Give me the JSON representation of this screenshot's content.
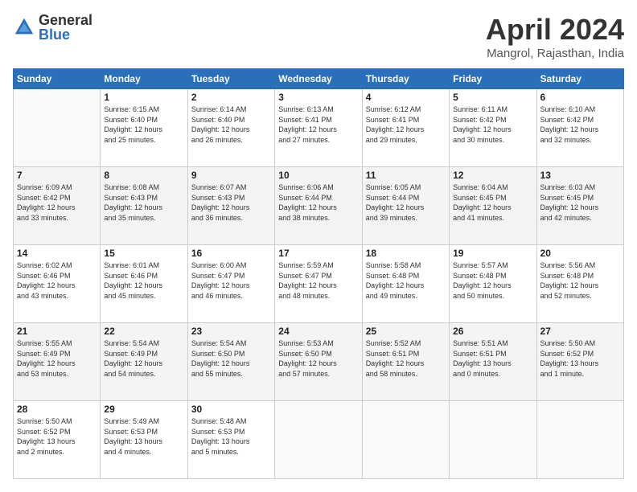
{
  "logo": {
    "general": "General",
    "blue": "Blue"
  },
  "title": {
    "month": "April 2024",
    "location": "Mangrol, Rajasthan, India"
  },
  "days_header": [
    "Sunday",
    "Monday",
    "Tuesday",
    "Wednesday",
    "Thursday",
    "Friday",
    "Saturday"
  ],
  "weeks": [
    [
      {
        "day": "",
        "info": ""
      },
      {
        "day": "1",
        "info": "Sunrise: 6:15 AM\nSunset: 6:40 PM\nDaylight: 12 hours\nand 25 minutes."
      },
      {
        "day": "2",
        "info": "Sunrise: 6:14 AM\nSunset: 6:40 PM\nDaylight: 12 hours\nand 26 minutes."
      },
      {
        "day": "3",
        "info": "Sunrise: 6:13 AM\nSunset: 6:41 PM\nDaylight: 12 hours\nand 27 minutes."
      },
      {
        "day": "4",
        "info": "Sunrise: 6:12 AM\nSunset: 6:41 PM\nDaylight: 12 hours\nand 29 minutes."
      },
      {
        "day": "5",
        "info": "Sunrise: 6:11 AM\nSunset: 6:42 PM\nDaylight: 12 hours\nand 30 minutes."
      },
      {
        "day": "6",
        "info": "Sunrise: 6:10 AM\nSunset: 6:42 PM\nDaylight: 12 hours\nand 32 minutes."
      }
    ],
    [
      {
        "day": "7",
        "info": "Sunrise: 6:09 AM\nSunset: 6:42 PM\nDaylight: 12 hours\nand 33 minutes."
      },
      {
        "day": "8",
        "info": "Sunrise: 6:08 AM\nSunset: 6:43 PM\nDaylight: 12 hours\nand 35 minutes."
      },
      {
        "day": "9",
        "info": "Sunrise: 6:07 AM\nSunset: 6:43 PM\nDaylight: 12 hours\nand 36 minutes."
      },
      {
        "day": "10",
        "info": "Sunrise: 6:06 AM\nSunset: 6:44 PM\nDaylight: 12 hours\nand 38 minutes."
      },
      {
        "day": "11",
        "info": "Sunrise: 6:05 AM\nSunset: 6:44 PM\nDaylight: 12 hours\nand 39 minutes."
      },
      {
        "day": "12",
        "info": "Sunrise: 6:04 AM\nSunset: 6:45 PM\nDaylight: 12 hours\nand 41 minutes."
      },
      {
        "day": "13",
        "info": "Sunrise: 6:03 AM\nSunset: 6:45 PM\nDaylight: 12 hours\nand 42 minutes."
      }
    ],
    [
      {
        "day": "14",
        "info": "Sunrise: 6:02 AM\nSunset: 6:46 PM\nDaylight: 12 hours\nand 43 minutes."
      },
      {
        "day": "15",
        "info": "Sunrise: 6:01 AM\nSunset: 6:46 PM\nDaylight: 12 hours\nand 45 minutes."
      },
      {
        "day": "16",
        "info": "Sunrise: 6:00 AM\nSunset: 6:47 PM\nDaylight: 12 hours\nand 46 minutes."
      },
      {
        "day": "17",
        "info": "Sunrise: 5:59 AM\nSunset: 6:47 PM\nDaylight: 12 hours\nand 48 minutes."
      },
      {
        "day": "18",
        "info": "Sunrise: 5:58 AM\nSunset: 6:48 PM\nDaylight: 12 hours\nand 49 minutes."
      },
      {
        "day": "19",
        "info": "Sunrise: 5:57 AM\nSunset: 6:48 PM\nDaylight: 12 hours\nand 50 minutes."
      },
      {
        "day": "20",
        "info": "Sunrise: 5:56 AM\nSunset: 6:48 PM\nDaylight: 12 hours\nand 52 minutes."
      }
    ],
    [
      {
        "day": "21",
        "info": "Sunrise: 5:55 AM\nSunset: 6:49 PM\nDaylight: 12 hours\nand 53 minutes."
      },
      {
        "day": "22",
        "info": "Sunrise: 5:54 AM\nSunset: 6:49 PM\nDaylight: 12 hours\nand 54 minutes."
      },
      {
        "day": "23",
        "info": "Sunrise: 5:54 AM\nSunset: 6:50 PM\nDaylight: 12 hours\nand 55 minutes."
      },
      {
        "day": "24",
        "info": "Sunrise: 5:53 AM\nSunset: 6:50 PM\nDaylight: 12 hours\nand 57 minutes."
      },
      {
        "day": "25",
        "info": "Sunrise: 5:52 AM\nSunset: 6:51 PM\nDaylight: 12 hours\nand 58 minutes."
      },
      {
        "day": "26",
        "info": "Sunrise: 5:51 AM\nSunset: 6:51 PM\nDaylight: 13 hours\nand 0 minutes."
      },
      {
        "day": "27",
        "info": "Sunrise: 5:50 AM\nSunset: 6:52 PM\nDaylight: 13 hours\nand 1 minute."
      }
    ],
    [
      {
        "day": "28",
        "info": "Sunrise: 5:50 AM\nSunset: 6:52 PM\nDaylight: 13 hours\nand 2 minutes."
      },
      {
        "day": "29",
        "info": "Sunrise: 5:49 AM\nSunset: 6:53 PM\nDaylight: 13 hours\nand 4 minutes."
      },
      {
        "day": "30",
        "info": "Sunrise: 5:48 AM\nSunset: 6:53 PM\nDaylight: 13 hours\nand 5 minutes."
      },
      {
        "day": "",
        "info": ""
      },
      {
        "day": "",
        "info": ""
      },
      {
        "day": "",
        "info": ""
      },
      {
        "day": "",
        "info": ""
      }
    ]
  ]
}
